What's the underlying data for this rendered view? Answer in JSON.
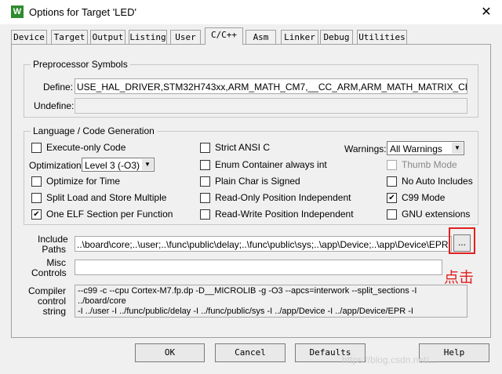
{
  "window": {
    "title": "Options for Target 'LED'",
    "app_icon": "W",
    "close_glyph": "✕"
  },
  "tabs": [
    {
      "label": "Device"
    },
    {
      "label": "Target"
    },
    {
      "label": "Output"
    },
    {
      "label": "Listing"
    },
    {
      "label": "User"
    },
    {
      "label": "C/C++",
      "active": true
    },
    {
      "label": "Asm"
    },
    {
      "label": "Linker"
    },
    {
      "label": "Debug"
    },
    {
      "label": "Utilities"
    }
  ],
  "preprocessor": {
    "group_label": "Preprocessor Symbols",
    "define_label": "Define:",
    "define_value": "USE_HAL_DRIVER,STM32H743xx,ARM_MATH_CM7,__CC_ARM,ARM_MATH_MATRIX_CHECK,ARM_",
    "undefine_label": "Undefine:",
    "undefine_value": ""
  },
  "language": {
    "group_label": "Language / Code Generation",
    "execute_only": {
      "label": "Execute-only Code",
      "checked": false
    },
    "optimization_label": "Optimization:",
    "optimization_value": "Level 3 (-O3)",
    "optimize_time": {
      "label": "Optimize for Time",
      "checked": false
    },
    "split_load": {
      "label": "Split Load and Store Multiple",
      "checked": false
    },
    "one_elf": {
      "label": "One ELF Section per Function",
      "checked": true
    },
    "strict_ansi": {
      "label": "Strict ANSI C",
      "checked": false
    },
    "enum_container": {
      "label": "Enum Container always int",
      "checked": false
    },
    "plain_char": {
      "label": "Plain Char is Signed",
      "checked": false
    },
    "ro_pi": {
      "label": "Read-Only Position Independent",
      "checked": false
    },
    "rw_pi": {
      "label": "Read-Write Position Independent",
      "checked": false
    },
    "warnings_label": "Warnings:",
    "warnings_value": "All Warnings",
    "thumb_mode": {
      "label": "Thumb Mode",
      "checked": false,
      "disabled": true
    },
    "no_auto_includes": {
      "label": "No Auto Includes",
      "checked": false
    },
    "c99_mode": {
      "label": "C99 Mode",
      "checked": true
    },
    "gnu_extensions": {
      "label": "GNU extensions",
      "checked": false
    }
  },
  "paths": {
    "include_label_1": "Include",
    "include_label_2": "Paths",
    "include_value": "..\\board\\core;..\\user;..\\func\\public\\delay;..\\func\\public\\sys;..\\app\\Device;..\\app\\Device\\EPR;..\\app",
    "browse_label": "...",
    "misc_label_1": "Misc",
    "misc_label_2": "Controls",
    "misc_value": "",
    "compiler_label_1": "Compiler",
    "compiler_label_2": "control",
    "compiler_label_3": "string",
    "compiler_line_1": "--c99 -c --cpu Cortex-M7.fp.dp -D__MICROLIB -g -O3 --apcs=interwork --split_sections -I ../board/core",
    "compiler_line_2": "-I ../user -I ../func/public/delay -I ../func/public/sys -I ../app/Device -I ../app/Device/EPR -I"
  },
  "annotation": {
    "text": "点击",
    "color": "#e02020"
  },
  "buttons": {
    "ok": "OK",
    "cancel": "Cancel",
    "defaults": "Defaults",
    "help": "Help"
  },
  "watermark": "https://blog.csdn.net/..."
}
